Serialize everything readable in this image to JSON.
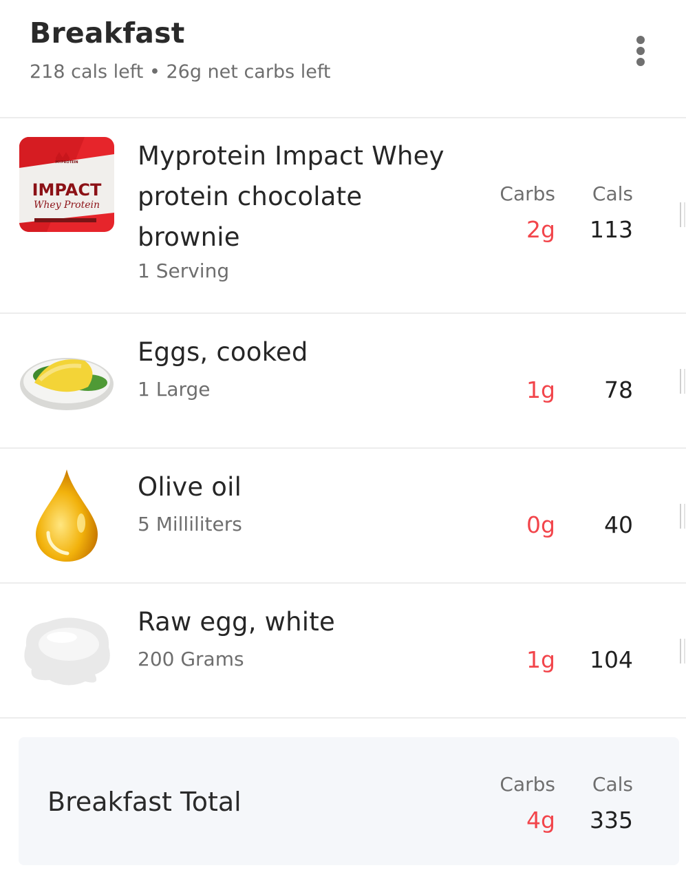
{
  "meal": {
    "title": "Breakfast",
    "summary": "218 cals left • 26g net carbs left"
  },
  "columns": {
    "carbs": "Carbs",
    "cals": "Cals"
  },
  "items": [
    {
      "name_lines": [
        "Myprotein Impact Whey",
        "protein chocolate",
        "brownie"
      ],
      "serving": "1 Serving",
      "carbs": "2g",
      "cals": "113",
      "image": "protein-powder-pouch"
    },
    {
      "name_lines": [
        "Eggs, cooked"
      ],
      "serving": "1 Large",
      "carbs": "1g",
      "cals": "78",
      "image": "omelette-on-plate"
    },
    {
      "name_lines": [
        "Olive oil"
      ],
      "serving": "5 Milliliters",
      "carbs": "0g",
      "cals": "40",
      "image": "oil-drop"
    },
    {
      "name_lines": [
        "Raw egg, white"
      ],
      "serving": "200 Grams",
      "carbs": "1g",
      "cals": "104",
      "image": "egg-white"
    }
  ],
  "total": {
    "label": "Breakfast Total",
    "carbs": "4g",
    "cals": "335"
  },
  "product_image_text": {
    "brand": "MYPROTEIN",
    "name": "IMPACT",
    "subname": "Whey Protein"
  },
  "colors": {
    "carbs": "#f2454b",
    "divider": "#ececec",
    "total_bg": "#f5f7fa"
  }
}
